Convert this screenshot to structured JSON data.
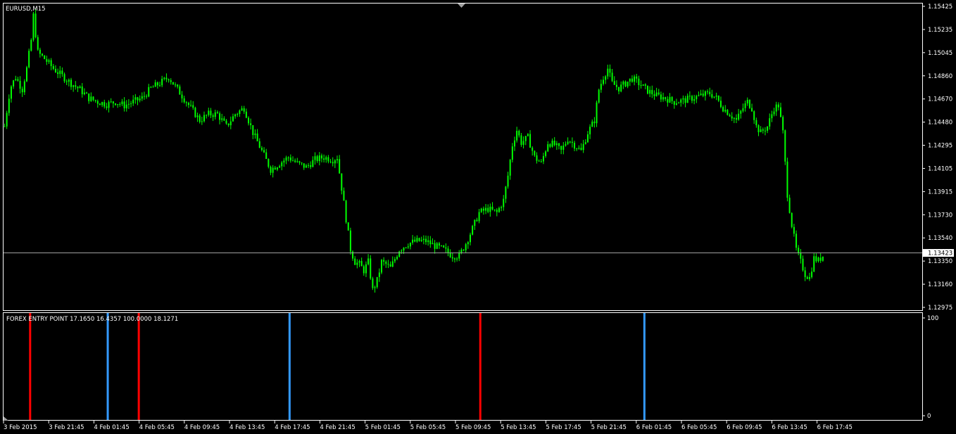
{
  "colors": {
    "background": "#000000",
    "frame": "#ffffff",
    "candle": "#00ff00",
    "price_line": "#a0a0a0",
    "sell_signal": "#ff0000",
    "buy_signal": "#3399ff",
    "text": "#ffffff"
  },
  "main_panel": {
    "title": "EURUSD,M15",
    "price_axis_labels": [
      "1.15425",
      "1.15235",
      "1.15045",
      "1.14860",
      "1.14670",
      "1.14480",
      "1.14295",
      "1.14105",
      "1.13915",
      "1.13730",
      "1.13540",
      "1.13350",
      "1.13160",
      "1.12975"
    ],
    "current_price": "1.13423"
  },
  "indicator_panel": {
    "title": "FOREX ENTRY POINT 17.1650 16.4357 100.0000 18.1271",
    "axis_labels": [
      "100",
      "0"
    ]
  },
  "time_axis_labels": [
    "3 Feb 2015",
    "3 Feb 21:45",
    "4 Feb 01:45",
    "4 Feb 05:45",
    "4 Feb 09:45",
    "4 Feb 13:45",
    "4 Feb 17:45",
    "4 Feb 21:45",
    "5 Feb 01:45",
    "5 Feb 05:45",
    "5 Feb 09:45",
    "5 Feb 13:45",
    "5 Feb 17:45",
    "5 Feb 21:45",
    "6 Feb 01:45",
    "6 Feb 05:45",
    "6 Feb 09:45",
    "6 Feb 13:45",
    "6 Feb 17:45"
  ],
  "chart_data": {
    "type": "candlestick",
    "symbol": "EURUSD",
    "timeframe": "M15",
    "ylim": [
      1.12975,
      1.15425
    ],
    "current_price": 1.13423,
    "price_path": [
      {
        "t": 0,
        "p": 1.1445
      },
      {
        "t": 2,
        "p": 1.147
      },
      {
        "t": 3,
        "p": 1.1478
      },
      {
        "t": 5,
        "p": 1.1485
      },
      {
        "t": 8,
        "p": 1.1475
      },
      {
        "t": 10,
        "p": 1.1492
      },
      {
        "t": 12,
        "p": 1.1515
      },
      {
        "t": 13,
        "p": 1.1535
      },
      {
        "t": 15,
        "p": 1.1505
      },
      {
        "t": 18,
        "p": 1.15
      },
      {
        "t": 22,
        "p": 1.1492
      },
      {
        "t": 26,
        "p": 1.1486
      },
      {
        "t": 30,
        "p": 1.148
      },
      {
        "t": 34,
        "p": 1.1475
      },
      {
        "t": 38,
        "p": 1.1468
      },
      {
        "t": 42,
        "p": 1.1465
      },
      {
        "t": 46,
        "p": 1.1463
      },
      {
        "t": 50,
        "p": 1.1465
      },
      {
        "t": 54,
        "p": 1.1462
      },
      {
        "t": 58,
        "p": 1.1465
      },
      {
        "t": 62,
        "p": 1.1468
      },
      {
        "t": 66,
        "p": 1.1476
      },
      {
        "t": 70,
        "p": 1.148
      },
      {
        "t": 74,
        "p": 1.1485
      },
      {
        "t": 76,
        "p": 1.148
      },
      {
        "t": 80,
        "p": 1.147
      },
      {
        "t": 84,
        "p": 1.146
      },
      {
        "t": 88,
        "p": 1.145
      },
      {
        "t": 92,
        "p": 1.1455
      },
      {
        "t": 96,
        "p": 1.1455
      },
      {
        "t": 100,
        "p": 1.1445
      },
      {
        "t": 104,
        "p": 1.1455
      },
      {
        "t": 108,
        "p": 1.146
      },
      {
        "t": 112,
        "p": 1.144
      },
      {
        "t": 116,
        "p": 1.1425
      },
      {
        "t": 120,
        "p": 1.141
      },
      {
        "t": 124,
        "p": 1.1415
      },
      {
        "t": 128,
        "p": 1.142
      },
      {
        "t": 132,
        "p": 1.1415
      },
      {
        "t": 136,
        "p": 1.1412
      },
      {
        "t": 140,
        "p": 1.1418
      },
      {
        "t": 144,
        "p": 1.142
      },
      {
        "t": 148,
        "p": 1.1418
      },
      {
        "t": 150,
        "p": 1.142
      },
      {
        "t": 152,
        "p": 1.1395
      },
      {
        "t": 154,
        "p": 1.137
      },
      {
        "t": 156,
        "p": 1.1345
      },
      {
        "t": 158,
        "p": 1.1335
      },
      {
        "t": 160,
        "p": 1.1333
      },
      {
        "t": 162,
        "p": 1.1328
      },
      {
        "t": 164,
        "p": 1.1335
      },
      {
        "t": 166,
        "p": 1.1312
      },
      {
        "t": 168,
        "p": 1.132
      },
      {
        "t": 170,
        "p": 1.1335
      },
      {
        "t": 172,
        "p": 1.1333
      },
      {
        "t": 174,
        "p": 1.133
      },
      {
        "t": 178,
        "p": 1.1345
      },
      {
        "t": 182,
        "p": 1.135
      },
      {
        "t": 186,
        "p": 1.1352
      },
      {
        "t": 190,
        "p": 1.1352
      },
      {
        "t": 194,
        "p": 1.1348
      },
      {
        "t": 198,
        "p": 1.1345
      },
      {
        "t": 202,
        "p": 1.134
      },
      {
        "t": 205,
        "p": 1.134
      },
      {
        "t": 208,
        "p": 1.135
      },
      {
        "t": 211,
        "p": 1.1362
      },
      {
        "t": 214,
        "p": 1.1375
      },
      {
        "t": 218,
        "p": 1.1378
      },
      {
        "t": 222,
        "p": 1.1375
      },
      {
        "t": 225,
        "p": 1.1385
      },
      {
        "t": 227,
        "p": 1.1405
      },
      {
        "t": 229,
        "p": 1.143
      },
      {
        "t": 231,
        "p": 1.1442
      },
      {
        "t": 233,
        "p": 1.1432
      },
      {
        "t": 236,
        "p": 1.1436
      },
      {
        "t": 239,
        "p": 1.142
      },
      {
        "t": 242,
        "p": 1.1415
      },
      {
        "t": 245,
        "p": 1.1432
      },
      {
        "t": 248,
        "p": 1.143
      },
      {
        "t": 251,
        "p": 1.1425
      },
      {
        "t": 254,
        "p": 1.1435
      },
      {
        "t": 257,
        "p": 1.143
      },
      {
        "t": 260,
        "p": 1.1425
      },
      {
        "t": 263,
        "p": 1.144
      },
      {
        "t": 266,
        "p": 1.145
      },
      {
        "t": 268,
        "p": 1.1475
      },
      {
        "t": 270,
        "p": 1.1485
      },
      {
        "t": 272,
        "p": 1.1492
      },
      {
        "t": 274,
        "p": 1.148
      },
      {
        "t": 277,
        "p": 1.1476
      },
      {
        "t": 280,
        "p": 1.148
      },
      {
        "t": 283,
        "p": 1.1484
      },
      {
        "t": 286,
        "p": 1.148
      },
      {
        "t": 290,
        "p": 1.1474
      },
      {
        "t": 294,
        "p": 1.147
      },
      {
        "t": 298,
        "p": 1.1468
      },
      {
        "t": 302,
        "p": 1.1465
      },
      {
        "t": 306,
        "p": 1.1466
      },
      {
        "t": 310,
        "p": 1.1468
      },
      {
        "t": 314,
        "p": 1.147
      },
      {
        "t": 318,
        "p": 1.1472
      },
      {
        "t": 321,
        "p": 1.1468
      },
      {
        "t": 324,
        "p": 1.146
      },
      {
        "t": 327,
        "p": 1.1455
      },
      {
        "t": 330,
        "p": 1.145
      },
      {
        "t": 333,
        "p": 1.146
      },
      {
        "t": 335,
        "p": 1.1465
      },
      {
        "t": 337,
        "p": 1.146
      },
      {
        "t": 339,
        "p": 1.1445
      },
      {
        "t": 341,
        "p": 1.144
      },
      {
        "t": 344,
        "p": 1.1445
      },
      {
        "t": 347,
        "p": 1.146
      },
      {
        "t": 349,
        "p": 1.1462
      },
      {
        "t": 351,
        "p": 1.144
      },
      {
        "t": 353,
        "p": 1.139
      },
      {
        "t": 355,
        "p": 1.1365
      },
      {
        "t": 357,
        "p": 1.1345
      },
      {
        "t": 359,
        "p": 1.1335
      },
      {
        "t": 361,
        "p": 1.1325
      },
      {
        "t": 363,
        "p": 1.1322
      },
      {
        "t": 365,
        "p": 1.1338
      },
      {
        "t": 367,
        "p": 1.1336
      },
      {
        "t": 369,
        "p": 1.134
      }
    ],
    "signals": [
      {
        "bar": 12,
        "type": "sell",
        "value": 100
      },
      {
        "bar": 47,
        "type": "buy",
        "value": 100
      },
      {
        "bar": 61,
        "type": "sell",
        "value": 100
      },
      {
        "bar": 129,
        "type": "buy",
        "value": 100
      },
      {
        "bar": 215,
        "type": "sell",
        "value": 100
      },
      {
        "bar": 289,
        "type": "buy",
        "value": 100
      }
    ],
    "indicator_ylim": [
      0,
      100
    ]
  }
}
